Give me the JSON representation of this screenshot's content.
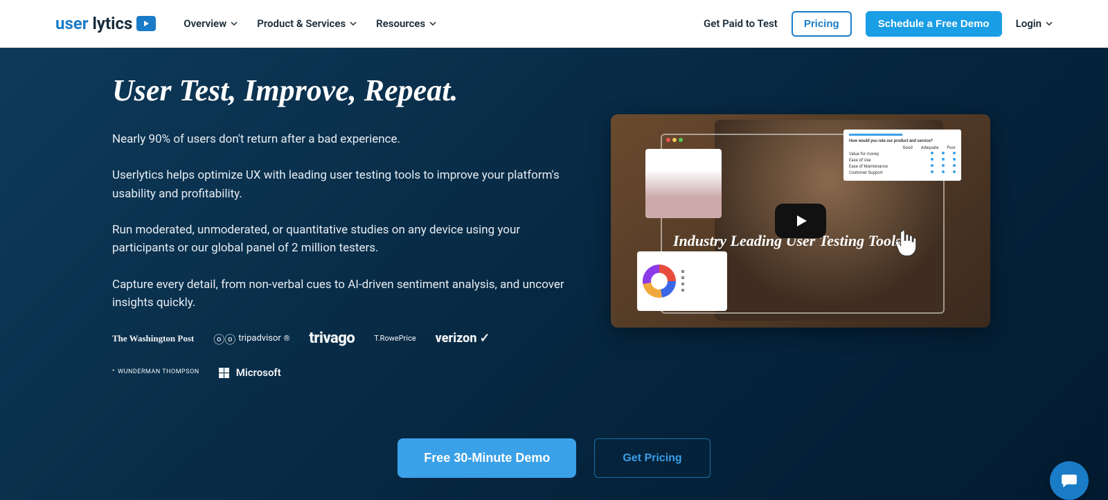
{
  "logo": {
    "part1": "user",
    "part2": "lytics"
  },
  "nav": {
    "items": [
      {
        "label": "Overview"
      },
      {
        "label": "Product & Services"
      },
      {
        "label": "Resources"
      }
    ]
  },
  "headerRight": {
    "getPaid": "Get Paid to Test",
    "pricing": "Pricing",
    "demo": "Schedule a Free Demo",
    "login": "Login"
  },
  "hero": {
    "title": "User Test, Improve, Repeat.",
    "p1": "Nearly 90% of users don't return after a bad experience.",
    "p2": "Userlytics helps optimize UX with leading user testing tools to improve your platform's usability and profitability.",
    "p3": "Run moderated, unmoderated, or quantitative studies on any device using your participants or our global panel of 2 million testers.",
    "p4": "Capture every detail, from non-verbal cues to AI-driven sentiment analysis, and uncover insights quickly."
  },
  "brands": {
    "wp": "The Washington Post",
    "trip": "tripadvisor",
    "trivago": "trivago",
    "trowe": "T.RowePrice",
    "verizon": "verizon",
    "wt": "WUNDERMAN THOMPSON",
    "ms": "Microsoft"
  },
  "video": {
    "overlayText": "Industry Leading User Testing Tools.",
    "rateCard": {
      "question": "How would you rate our product and service?",
      "cols": [
        "Good",
        "Adequate",
        "Poor"
      ],
      "rows": [
        "Value for money",
        "Ease of Use",
        "Ease of Maintenance",
        "Customer Support"
      ]
    }
  },
  "cta": {
    "demo": "Free 30-Minute Demo",
    "pricing": "Get Pricing"
  }
}
